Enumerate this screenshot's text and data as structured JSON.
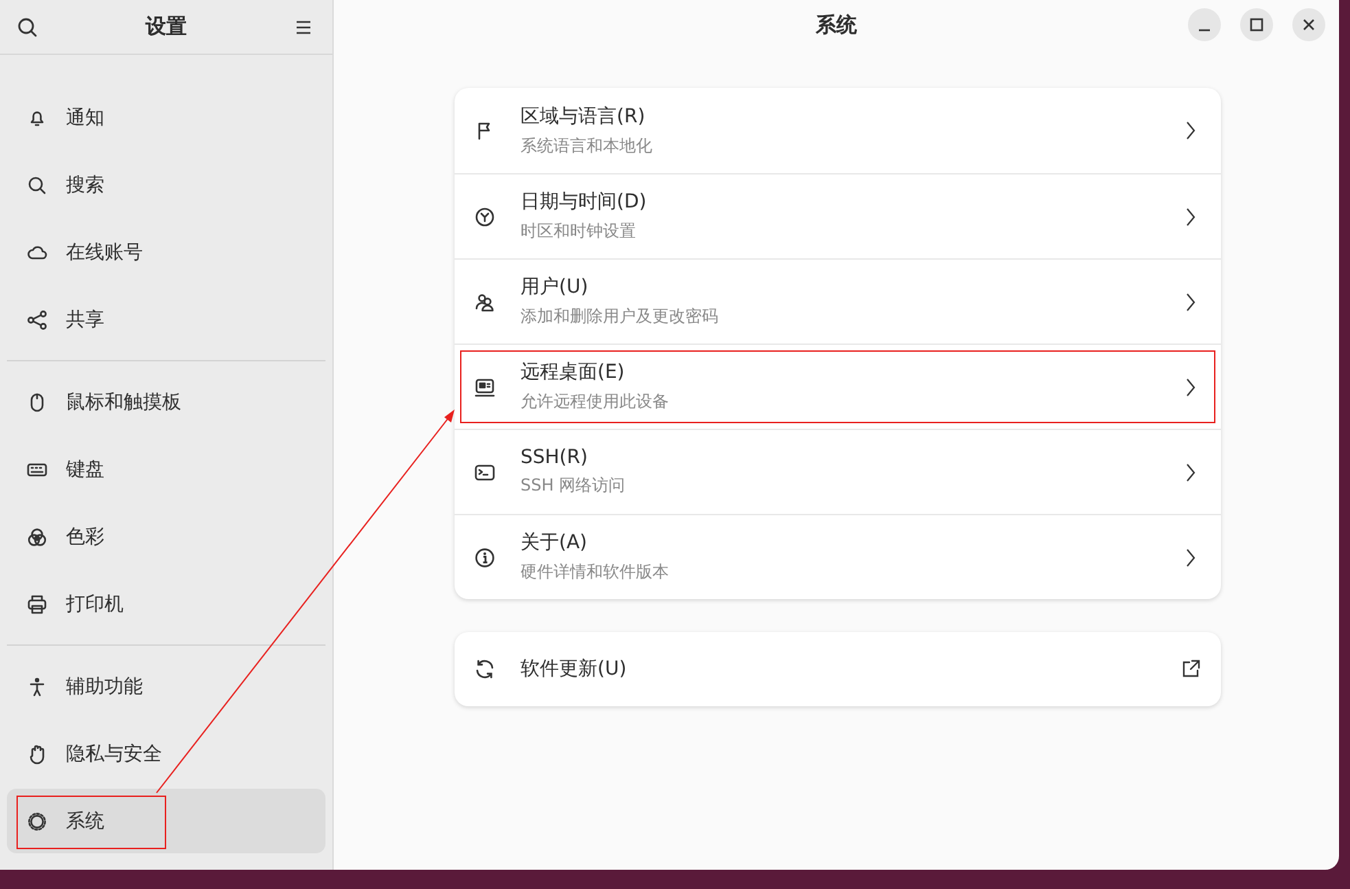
{
  "sidebar": {
    "title": "设置",
    "groups": [
      {
        "items": [
          {
            "label": "通知",
            "selected": false,
            "highlighted": false
          },
          {
            "label": "搜索",
            "selected": false,
            "highlighted": false
          },
          {
            "label": "在线账号",
            "selected": false,
            "highlighted": false
          },
          {
            "label": "共享",
            "selected": false,
            "highlighted": false
          }
        ]
      },
      {
        "items": [
          {
            "label": "鼠标和触摸板",
            "selected": false,
            "highlighted": false
          },
          {
            "label": "键盘",
            "selected": false,
            "highlighted": false
          },
          {
            "label": "色彩",
            "selected": false,
            "highlighted": false
          },
          {
            "label": "打印机",
            "selected": false,
            "highlighted": false
          }
        ]
      },
      {
        "items": [
          {
            "label": "辅助功能",
            "selected": false,
            "highlighted": false
          },
          {
            "label": "隐私与安全",
            "selected": false,
            "highlighted": false
          },
          {
            "label": "系统",
            "selected": true,
            "highlighted": true
          }
        ]
      }
    ]
  },
  "main": {
    "title": "系统",
    "rows": [
      {
        "title": "区域与语言(R)",
        "subtitle": "系统语言和本地化",
        "highlighted": false
      },
      {
        "title": "日期与时间(D)",
        "subtitle": "时区和时钟设置",
        "highlighted": false
      },
      {
        "title": "用户(U)",
        "subtitle": "添加和删除用户及更改密码",
        "highlighted": false
      },
      {
        "title": "远程桌面(E)",
        "subtitle": "允许远程使用此设备",
        "highlighted": true
      },
      {
        "title": "SSH(R)",
        "subtitle": "SSH 网络访问",
        "highlighted": false
      },
      {
        "title": "关于(A)",
        "subtitle": "硬件详情和软件版本",
        "highlighted": false
      }
    ],
    "update_row": {
      "title": "软件更新(U)"
    }
  }
}
